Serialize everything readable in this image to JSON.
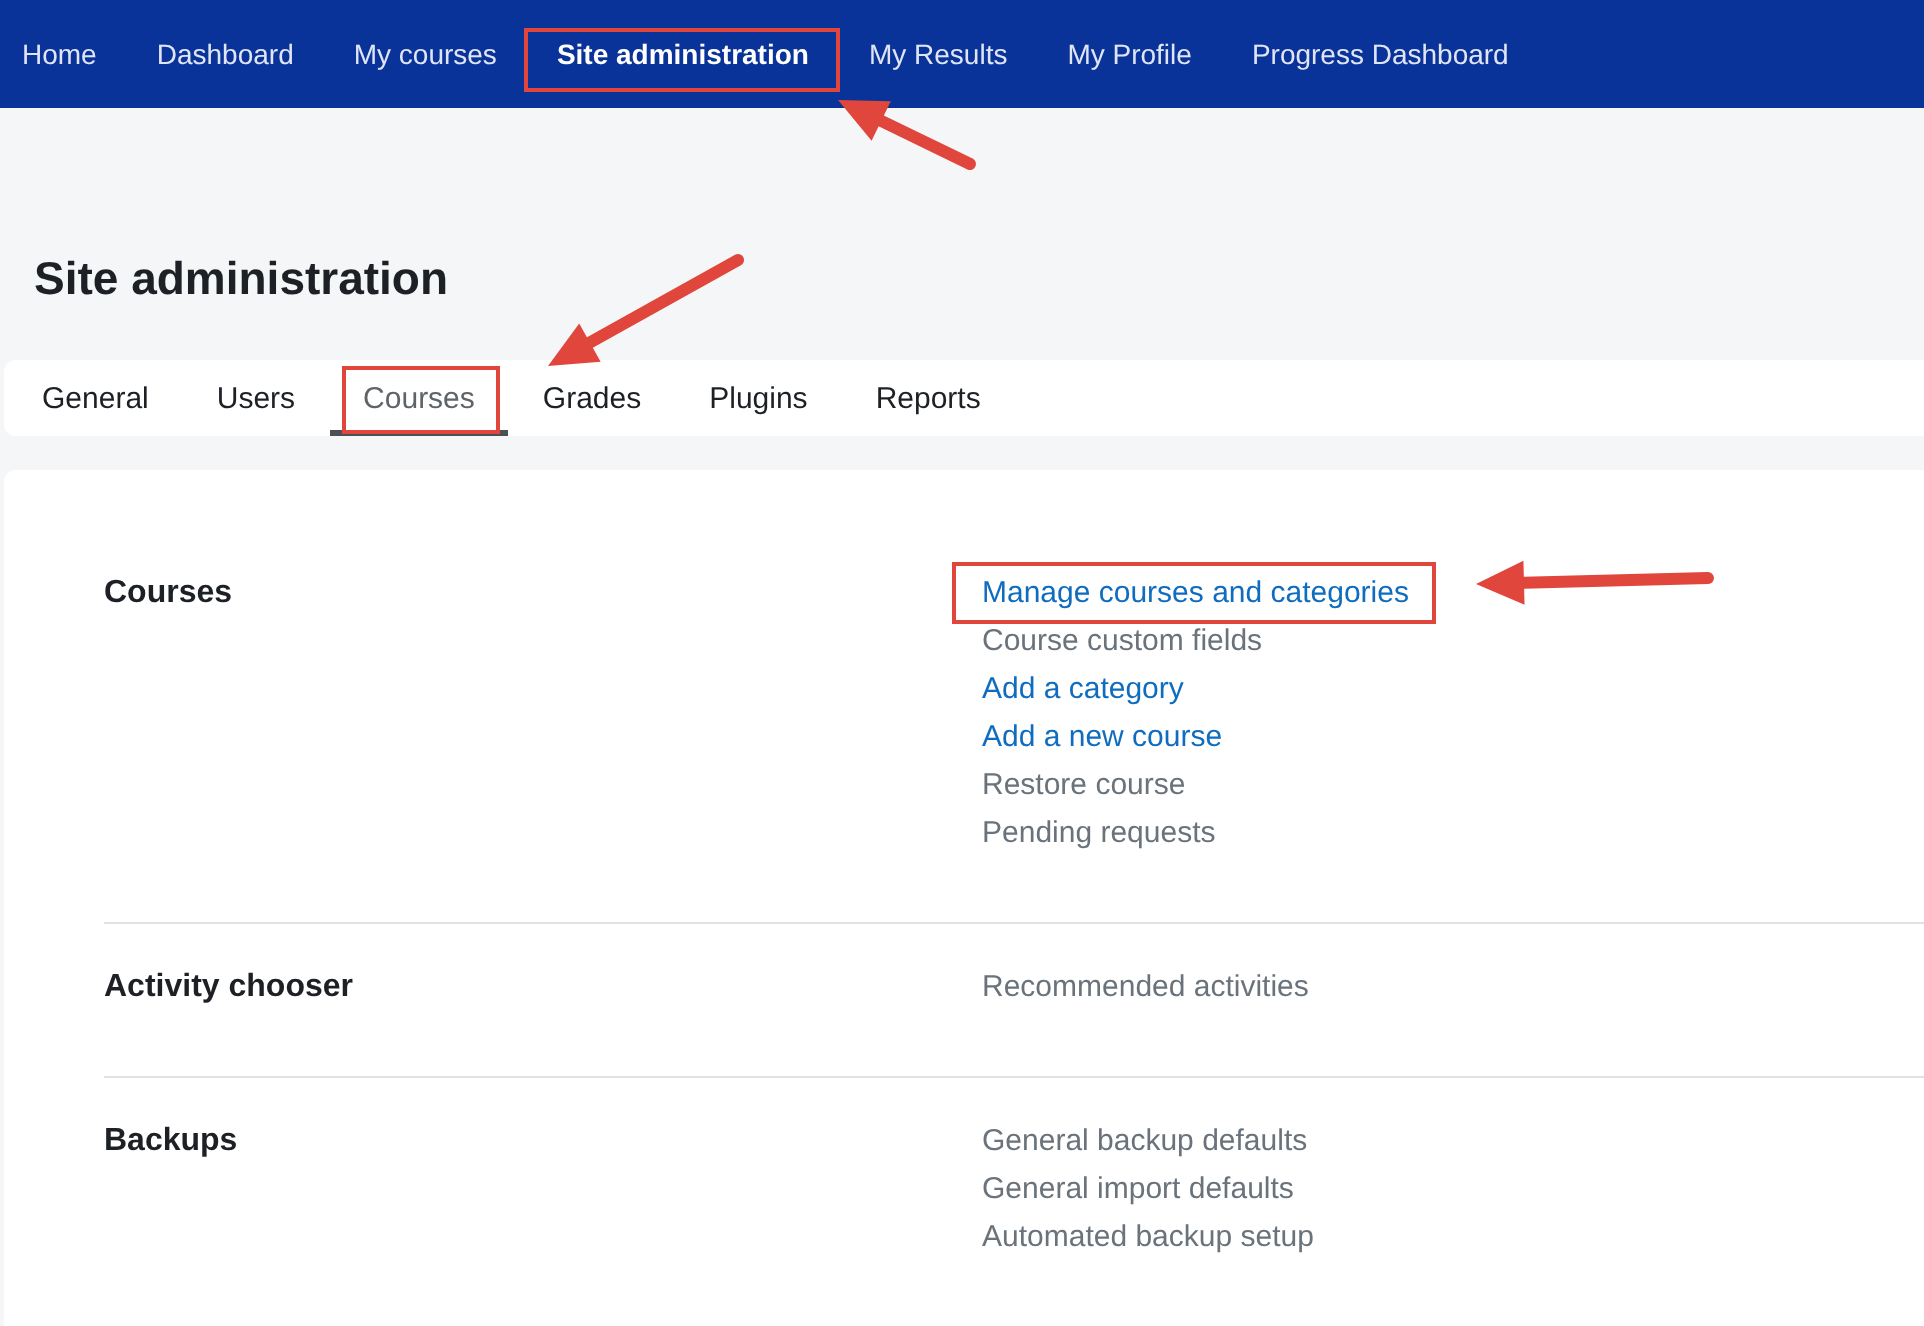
{
  "nav": {
    "items": [
      {
        "label": "Home",
        "selected": false,
        "highlighted": false
      },
      {
        "label": "Dashboard",
        "selected": false,
        "highlighted": false
      },
      {
        "label": "My courses",
        "selected": false,
        "highlighted": false
      },
      {
        "label": "Site administration",
        "selected": true,
        "highlighted": true
      },
      {
        "label": "My Results",
        "selected": false,
        "highlighted": false
      },
      {
        "label": "My Profile",
        "selected": false,
        "highlighted": false
      },
      {
        "label": "Progress Dashboard",
        "selected": false,
        "highlighted": false
      }
    ]
  },
  "page_title": "Site administration",
  "tabs": [
    {
      "label": "General",
      "selected": false,
      "highlighted": false
    },
    {
      "label": "Users",
      "selected": false,
      "highlighted": false
    },
    {
      "label": "Courses",
      "selected": true,
      "highlighted": true
    },
    {
      "label": "Grades",
      "selected": false,
      "highlighted": false
    },
    {
      "label": "Plugins",
      "selected": false,
      "highlighted": false
    },
    {
      "label": "Reports",
      "selected": false,
      "highlighted": false
    }
  ],
  "sections": [
    {
      "heading": "Courses",
      "links": [
        {
          "label": "Manage courses and categories",
          "kind": "link",
          "highlighted": true
        },
        {
          "label": "Course custom fields",
          "kind": "plain",
          "highlighted": false
        },
        {
          "label": "Add a category",
          "kind": "link",
          "highlighted": false
        },
        {
          "label": "Add a new course",
          "kind": "link",
          "highlighted": false
        },
        {
          "label": "Restore course",
          "kind": "plain",
          "highlighted": false
        },
        {
          "label": "Pending requests",
          "kind": "plain",
          "highlighted": false
        }
      ]
    },
    {
      "heading": "Activity chooser",
      "links": [
        {
          "label": "Recommended activities",
          "kind": "plain",
          "highlighted": false
        }
      ]
    },
    {
      "heading": "Backups",
      "links": [
        {
          "label": "General backup defaults",
          "kind": "plain",
          "highlighted": false
        },
        {
          "label": "General import defaults",
          "kind": "plain",
          "highlighted": false
        },
        {
          "label": "Automated backup setup",
          "kind": "plain",
          "highlighted": false
        }
      ]
    }
  ]
}
